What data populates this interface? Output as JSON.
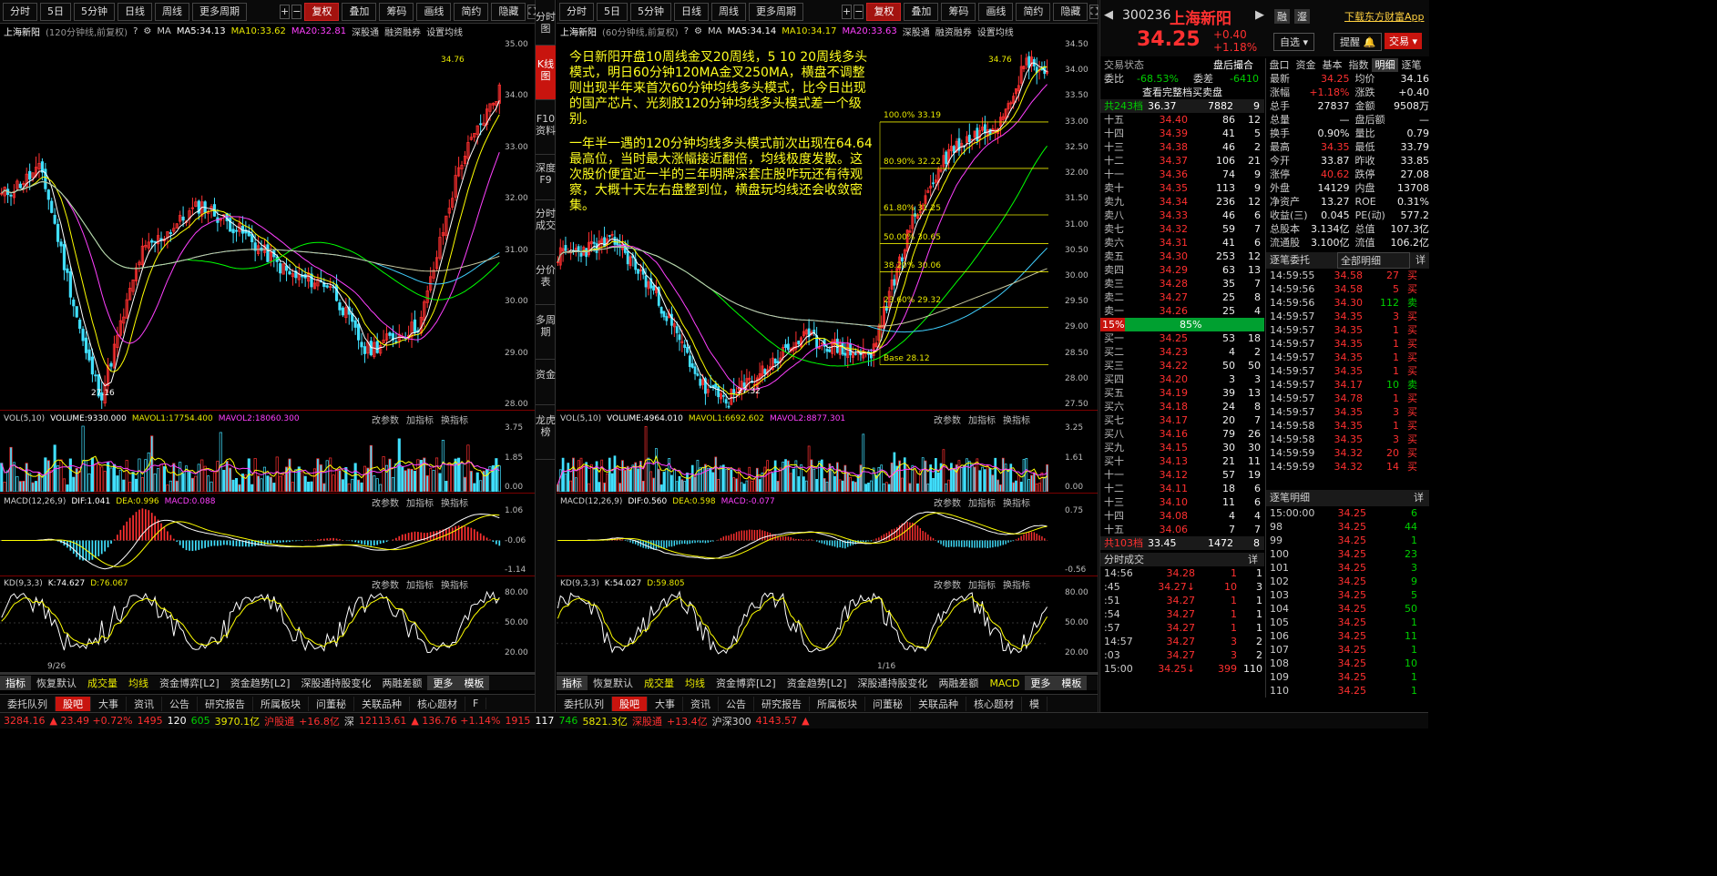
{
  "toolbar": {
    "tabs": [
      "分时",
      "5日",
      "5分钟",
      "日线",
      "周线",
      "更多周期"
    ],
    "fq": "复权",
    "overlay": "叠加",
    "chip": "筹码",
    "draw": "画线",
    "simple": "简约",
    "hide": "隐藏"
  },
  "left_chart": {
    "name": "上海新阳",
    "period": "(120分钟线,前复权)",
    "ma_label": "MA",
    "ma5": "MA5:34.13",
    "ma10": "MA10:33.62",
    "ma20": "MA20:32.81",
    "hk": "深股通",
    "margin": "融资融券",
    "settings": "设置均线",
    "high": "34.76",
    "low": "27.16",
    "yticks": [
      "35.00",
      "34.00",
      "33.00",
      "32.00",
      "31.00",
      "30.00",
      "29.00",
      "28.00"
    ],
    "date": "9/26",
    "vol": {
      "label": "VOL(5,10)",
      "v": "VOLUME:9330.000",
      "m1": "MAVOL1:17754.400",
      "m2": "MAVOL2:18060.300",
      "ticks": [
        "3.75",
        "1.85",
        "0.00"
      ]
    },
    "macd": {
      "label": "MACD(12,26,9)",
      "dif": "DIF:1.041",
      "dea": "DEA:0.996",
      "macd": "MACD:0.088",
      "ticks": [
        "1.06",
        "-0.06",
        "-1.14"
      ]
    },
    "kd": {
      "label": "KD(9,3,3)",
      "k": "K:74.627",
      "d": "D:76.067",
      "ticks": [
        "80.00",
        "50.00",
        "20.00"
      ]
    }
  },
  "right_chart": {
    "name": "上海新阳",
    "period": "(60分钟线,前复权)",
    "ma_label": "MA",
    "ma5": "MA5:34.14",
    "ma10": "MA10:34.17",
    "ma20": "MA20:33.63",
    "hk": "深股通",
    "margin": "融资融券",
    "settings": "设置均线",
    "high": "34.76",
    "low": "27.32",
    "yticks": [
      "34.50",
      "34.00",
      "33.50",
      "33.00",
      "32.50",
      "32.00",
      "31.50",
      "31.00",
      "30.50",
      "30.00",
      "29.50",
      "29.00",
      "28.50",
      "28.00",
      "27.50"
    ],
    "date": "1/16",
    "fib": [
      {
        "t": "100.0% 33.19"
      },
      {
        "t": "80.90% 32.22"
      },
      {
        "t": "61.80% 31.25"
      },
      {
        "t": "50.00% 30.65"
      },
      {
        "t": "38.20% 30.06"
      },
      {
        "t": "23.60% 29.32"
      },
      {
        "t": "Base  28.12"
      }
    ],
    "note1": "今日新阳开盘10周线金叉20周线，5 10 20周线多头模式，明日60分钟120MA金叉250MA，横盘不调整则出现半年来首次60分钟均线多头模式，比今日出现的国产芯片、光刻胶120分钟均线多头模式差一个级别。",
    "note2": "一年半一遇的120分钟均线多头模式前次出现在64.64最高位，当时最大涨幅接近翻倍，均线极度发散。这次股价便宜近一半的三年明牌深套庄股咋玩还有待观察，大概十天左右盘整到位，横盘玩均线还会收敛密集。",
    "vol": {
      "label": "VOL(5,10)",
      "v": "VOLUME:4964.010",
      "m1": "MAVOL1:6692.602",
      "m2": "MAVOL2:8877.301",
      "ticks": [
        "3.25",
        "1.61",
        "0.00"
      ]
    },
    "macd": {
      "label": "MACD(12,26,9)",
      "dif": "DIF:0.560",
      "dea": "DEA:0.598",
      "macd": "MACD:-0.077",
      "ticks": [
        "0.75",
        "-0.56"
      ]
    },
    "kd": {
      "label": "KD(9,3,3)",
      "k": "K:54.027",
      "d": "D:59.805",
      "ticks": [
        "80.00",
        "50.00",
        "20.00"
      ]
    }
  },
  "ind_links": [
    "改参数",
    "加指标",
    "换指标"
  ],
  "bottom_tabs": [
    "指标",
    "恢复默认",
    "成交量",
    "均线",
    "资金博弈[L2]",
    "资金趋势[L2]",
    "深股通持股变化",
    "两融差额",
    "更多",
    "模板"
  ],
  "bottom_tabs_r": [
    "指标",
    "恢复默认",
    "成交量",
    "均线",
    "资金博弈[L2]",
    "资金趋势[L2]",
    "深股通持股变化",
    "两融差额",
    "MACD",
    "更多",
    "模板"
  ],
  "tab2": [
    "委托队列",
    "股吧",
    "大事",
    "资讯",
    "公告",
    "研究报告",
    "所属板块",
    "问董秘",
    "关联品种",
    "核心题材",
    "F"
  ],
  "tab2r": [
    "委托队列",
    "股吧",
    "大事",
    "资讯",
    "公告",
    "研究报告",
    "所属板块",
    "问董秘",
    "关联品种",
    "核心题材",
    "模"
  ],
  "vtabs": [
    "分时图",
    "K线图",
    "F10资料",
    "深度F9",
    "分时成交",
    "分价表",
    "多周期",
    "资金",
    "龙虎榜"
  ],
  "stock": {
    "code": "300236",
    "name": "上海新阳",
    "price": "34.25",
    "chg": "+0.40",
    "pct": "+1.18%",
    "rong": "融",
    "zhuan": "瀣",
    "download": "下载东方财富App",
    "zixuan": "自选",
    "tixing": "提醒",
    "jiaoyi": "交易"
  },
  "state": {
    "label": "交易状态",
    "value": "盘后撮合",
    "weibi": "委比",
    "wb": "-68.53%",
    "weicha": "委差",
    "wc": "-6410",
    "show_all": "查看完整档买卖盘",
    "sell_total": "共243档",
    "sell_p": "36.37",
    "sell_v": "7882",
    "sell_n": "9",
    "buy_total": "共103档",
    "buy_p": "33.45",
    "buy_v": "1472",
    "buy_n": "8",
    "pct_l": "15%",
    "pct_r": "85%"
  },
  "sells": [
    [
      "十五",
      "34.40",
      "86",
      "12"
    ],
    [
      "十四",
      "34.39",
      "41",
      "5"
    ],
    [
      "十三",
      "34.38",
      "46",
      "2"
    ],
    [
      "十二",
      "34.37",
      "106",
      "21"
    ],
    [
      "十一",
      "34.36",
      "74",
      "9"
    ],
    [
      "卖十",
      "34.35",
      "113",
      "9"
    ],
    [
      "卖九",
      "34.34",
      "236",
      "12"
    ],
    [
      "卖八",
      "34.33",
      "46",
      "6"
    ],
    [
      "卖七",
      "34.32",
      "59",
      "7"
    ],
    [
      "卖六",
      "34.31",
      "41",
      "6"
    ],
    [
      "卖五",
      "34.30",
      "253",
      "12"
    ],
    [
      "卖四",
      "34.29",
      "63",
      "13"
    ],
    [
      "卖三",
      "34.28",
      "35",
      "7"
    ],
    [
      "卖二",
      "34.27",
      "25",
      "8"
    ],
    [
      "卖一",
      "34.26",
      "25",
      "4"
    ]
  ],
  "buys": [
    [
      "买一",
      "34.25",
      "53",
      "18"
    ],
    [
      "买二",
      "34.23",
      "4",
      "2"
    ],
    [
      "买三",
      "34.22",
      "50",
      "50"
    ],
    [
      "买四",
      "34.20",
      "3",
      "3"
    ],
    [
      "买五",
      "34.19",
      "39",
      "13"
    ],
    [
      "买六",
      "34.18",
      "24",
      "8"
    ],
    [
      "买七",
      "34.17",
      "20",
      "7"
    ],
    [
      "买八",
      "34.16",
      "79",
      "26"
    ],
    [
      "买九",
      "34.15",
      "30",
      "30"
    ],
    [
      "买十",
      "34.13",
      "21",
      "11"
    ],
    [
      "十一",
      "34.12",
      "57",
      "19"
    ],
    [
      "十二",
      "34.11",
      "18",
      "6"
    ],
    [
      "十三",
      "34.10",
      "11",
      "6"
    ],
    [
      "十四",
      "34.08",
      "4",
      "4"
    ],
    [
      "十五",
      "34.06",
      "7",
      "7"
    ]
  ],
  "mini_tabs": [
    "盘口",
    "资金",
    "基本",
    "指数",
    "明细",
    "逐笔"
  ],
  "stats": [
    [
      "最新",
      "34.25",
      "均价",
      "34.16"
    ],
    [
      "涨幅",
      "+1.18%",
      "涨跌",
      "+0.40"
    ],
    [
      "总手",
      "27837",
      "金额",
      "9508万"
    ],
    [
      "总量",
      "—",
      "盘后额",
      "—"
    ],
    [
      "换手",
      "0.90%",
      "量比",
      "0.79"
    ],
    [
      "最高",
      "34.35",
      "最低",
      "33.79"
    ],
    [
      "今开",
      "33.87",
      "昨收",
      "33.85"
    ],
    [
      "涨停",
      "40.62",
      "跌停",
      "27.08"
    ],
    [
      "外盘",
      "14129",
      "内盘",
      "13708"
    ],
    [
      "净资产",
      "13.27",
      "ROE",
      "0.31%"
    ],
    [
      "收益(三)",
      "0.045",
      "PE(动)",
      "577.2"
    ],
    [
      "总股本",
      "3.134亿",
      "总值",
      "107.3亿"
    ],
    [
      "流通股",
      "3.100亿",
      "流值",
      "106.2亿"
    ]
  ],
  "zbwt": {
    "title": "逐笔委托",
    "sel": "全部明细",
    "more": "详"
  },
  "zbwt_rows": [
    [
      "14:59:55",
      "34.58",
      "27",
      "买"
    ],
    [
      "14:59:56",
      "34.58",
      "5",
      "买"
    ],
    [
      "14:59:56",
      "34.30",
      "112",
      "卖"
    ],
    [
      "14:59:57",
      "34.35",
      "3",
      "买"
    ],
    [
      "14:59:57",
      "34.35",
      "1",
      "买"
    ],
    [
      "14:59:57",
      "34.35",
      "1",
      "买"
    ],
    [
      "14:59:57",
      "34.35",
      "1",
      "买"
    ],
    [
      "14:59:57",
      "34.35",
      "1",
      "买"
    ],
    [
      "14:59:57",
      "34.17",
      "10",
      "卖"
    ],
    [
      "14:59:57",
      "34.78",
      "1",
      "买"
    ],
    [
      "14:59:57",
      "34.35",
      "3",
      "买"
    ],
    [
      "14:59:58",
      "34.35",
      "1",
      "买"
    ],
    [
      "14:59:58",
      "34.35",
      "3",
      "买"
    ],
    [
      "14:59:59",
      "34.32",
      "20",
      "买"
    ],
    [
      "14:59:59",
      "34.32",
      "14",
      "买"
    ]
  ],
  "zbmx": {
    "title": "逐笔明细",
    "more": "详"
  },
  "zbmx_rows": [
    [
      "15:00:00",
      "34.25",
      "6"
    ],
    [
      "98",
      "34.25",
      "44"
    ],
    [
      "99",
      "34.25",
      "1"
    ],
    [
      "100",
      "34.25",
      "23"
    ],
    [
      "101",
      "34.25",
      "3"
    ],
    [
      "102",
      "34.25",
      "9"
    ],
    [
      "103",
      "34.25",
      "5"
    ],
    [
      "104",
      "34.25",
      "50"
    ],
    [
      "105",
      "34.25",
      "1"
    ],
    [
      "106",
      "34.25",
      "11"
    ],
    [
      "107",
      "34.25",
      "1"
    ],
    [
      "108",
      "34.25",
      "10"
    ],
    [
      "109",
      "34.25",
      "1"
    ],
    [
      "110",
      "34.25",
      "1"
    ]
  ],
  "fscj": {
    "title": "分时成交",
    "more": "详"
  },
  "fscj_rows": [
    [
      "14:56",
      "34.28",
      "1",
      "1"
    ],
    [
      ":45",
      "34.27↓",
      "10",
      "3"
    ],
    [
      ":51",
      "34.27",
      "1",
      "1"
    ],
    [
      ":54",
      "34.27",
      "1",
      "1"
    ],
    [
      ":57",
      "34.27",
      "1",
      "1"
    ],
    [
      "14:57",
      "34.27",
      "3",
      "2"
    ],
    [
      ":03",
      "34.27",
      "3",
      "2"
    ],
    [
      "15:00",
      "34.25↓",
      "399",
      "110"
    ]
  ],
  "status": {
    "i1": "3284.16",
    "i1c": "▲ 23.49 +0.72%",
    "i1n": "1495",
    "i1a": "120",
    "i1b": "605",
    "i1v": "3970.1亿",
    "hk1": "沪股通",
    "hk1v": "+16.8亿",
    "s": "深",
    "i2": "12113.61",
    "i2c": "▲ 136.76 +1.14%",
    "i2n": "1915",
    "i2a": "117",
    "i2b": "746",
    "i2v": "5821.3亿",
    "hk2": "深股通",
    "hk2v": "+13.4亿",
    "cy": "沪深300",
    "cyv": "4143.57",
    "cyc": "▲"
  }
}
